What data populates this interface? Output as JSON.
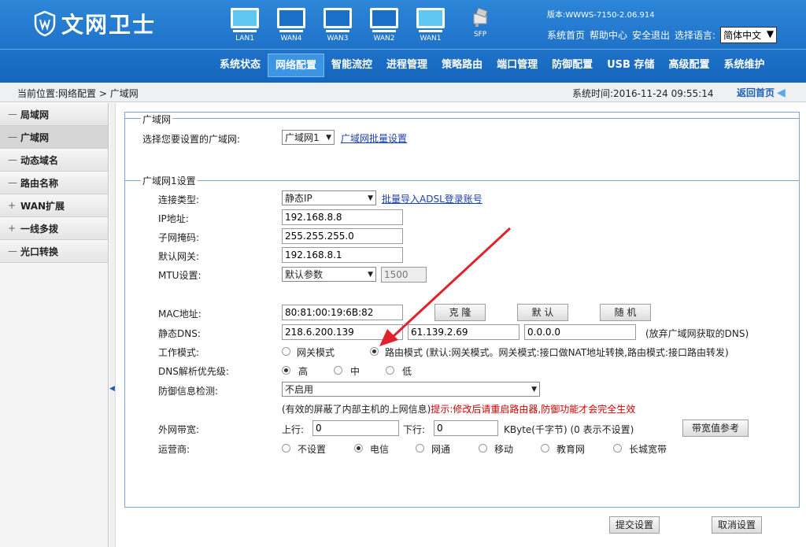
{
  "header": {
    "logo_text": "文网卫士",
    "ports": [
      {
        "label": "LAN1",
        "active": true
      },
      {
        "label": "WAN4",
        "active": false
      },
      {
        "label": "WAN3",
        "active": false
      },
      {
        "label": "WAN2",
        "active": false
      },
      {
        "label": "WAN1",
        "active": true
      }
    ],
    "sfp_label": "SFP",
    "version": "版本:WWWS-7150-2.06.914",
    "links": [
      "系统首页",
      "帮助中心",
      "安全退出",
      "选择语言:"
    ],
    "language": "简体中文"
  },
  "nav": [
    "系统状态",
    "网络配置",
    "智能流控",
    "进程管理",
    "策略路由",
    "端口管理",
    "防御配置",
    "USB 存储",
    "高级配置",
    "系统维护"
  ],
  "nav_active": "网络配置",
  "breadcrumb": {
    "path": "当前位置:网络配置  >  广域网",
    "time": "系统时间:2016-11-24 09:55:14",
    "home": "返回首页"
  },
  "sidebar": [
    {
      "pm": "—",
      "label": "局域网"
    },
    {
      "pm": "—",
      "label": "广域网"
    },
    {
      "pm": "—",
      "label": "动态域名"
    },
    {
      "pm": "—",
      "label": "路由名称"
    },
    {
      "pm": "+",
      "label": "WAN扩展"
    },
    {
      "pm": "+",
      "label": "一线多拨"
    },
    {
      "pm": "—",
      "label": "光口转换"
    }
  ],
  "form": {
    "legend1": "广域网",
    "choose_label": "选择您要设置的广域网:",
    "choose_value": "广域网1",
    "batch_link": "广域网批量设置",
    "legend2": "广域网1设置",
    "conn_label": "连接类型:",
    "conn_value": "静态IP",
    "adsl_link": "批量导入ADSL登录账号",
    "ip_label": "IP地址:",
    "ip_value": "192.168.8.8",
    "mask_label": "子网掩码:",
    "mask_value": "255.255.255.0",
    "gw_label": "默认网关:",
    "gw_value": "192.168.8.1",
    "mtu_label": "MTU设置:",
    "mtu_select": "默认参数",
    "mtu_value": "1500",
    "mac_label": "MAC地址:",
    "mac_value": "80:81:00:19:6B:82",
    "btn_clone": "克 隆",
    "btn_default": "默 认",
    "btn_random": "随 机",
    "dns_label": "静态DNS:",
    "dns1": "218.6.200.139",
    "dns2": "61.139.2.69",
    "dns3": "0.0.0.0",
    "dns_note": "(放弃广域网获取的DNS)",
    "mode_label": "工作模式:",
    "mode_gw": "网关模式",
    "mode_route": "路由模式 (默认:网关模式。网关模式:接口做NAT地址转换,路由模式:接口路由转发)",
    "dnspri_label": "DNS解析优先级:",
    "pri_high": "高",
    "pri_mid": "中",
    "pri_low": "低",
    "defense_label": "防御信息检测:",
    "defense_value": "不启用",
    "defense_note": "(有效的屏蔽了内部主机的上网信息)",
    "defense_tip": "提示:修改后请重启路由器,防御功能才会完全生效",
    "bw_label": "外网带宽:",
    "up_label": "上行:",
    "up_value": "0",
    "down_label": "下行:",
    "down_value": "0",
    "bw_unit": "KByte(千字节)  (0 表示不设置)",
    "bw_btn": "带宽值参考",
    "isp_label": "运营商:",
    "isps": [
      "不设置",
      "电信",
      "网通",
      "移动",
      "教育网",
      "长城宽带"
    ],
    "isp_selected": "电信",
    "submit": "提交设置",
    "cancel": "取消设置"
  }
}
